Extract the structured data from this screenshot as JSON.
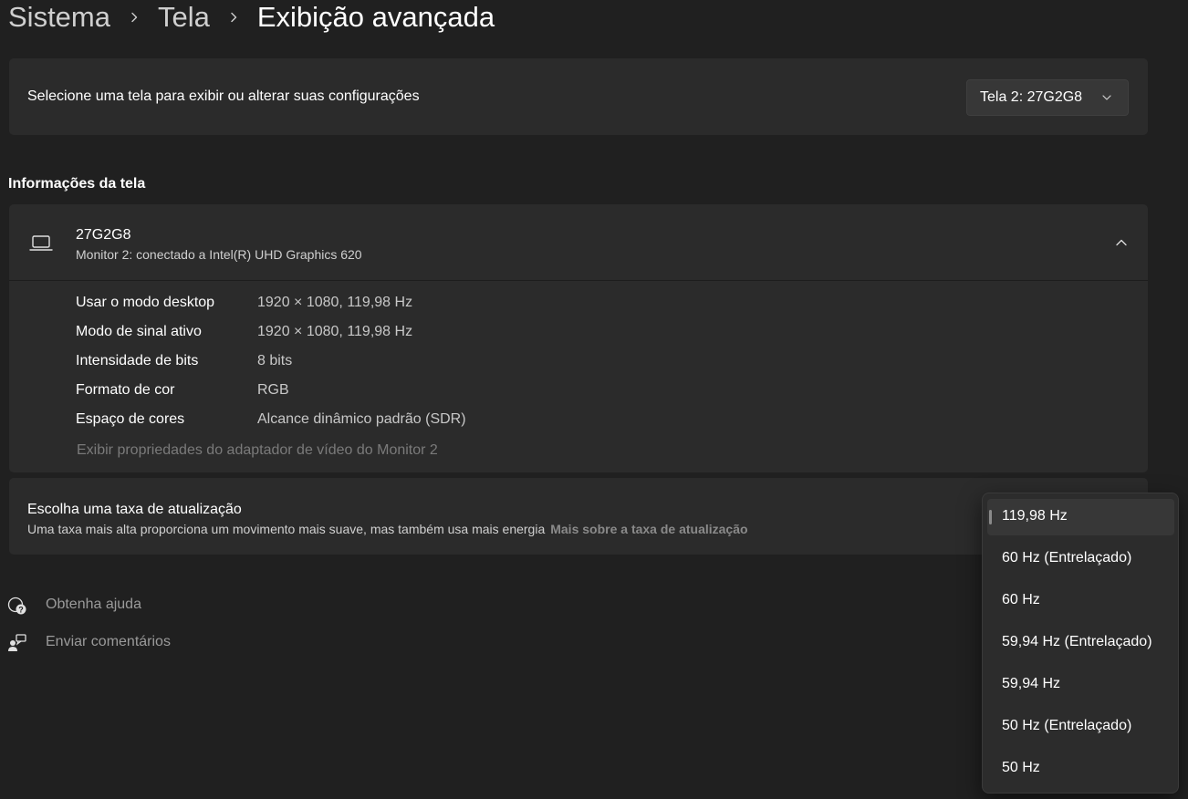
{
  "breadcrumb": {
    "items": [
      "Sistema",
      "Tela",
      "Exibição avançada"
    ]
  },
  "display_select": {
    "label": "Selecione uma tela para exibir ou alterar suas configurações",
    "selected": "Tela 2: 27G2G8"
  },
  "section_title": "Informações da tela",
  "monitor": {
    "name": "27G2G8",
    "subtitle": "Monitor 2: conectado a Intel(R) UHD Graphics 620",
    "details": [
      {
        "key": "Usar o modo desktop",
        "value": "1920 × 1080, 119,98 Hz"
      },
      {
        "key": "Modo de sinal ativo",
        "value": "1920 × 1080, 119,98 Hz"
      },
      {
        "key": "Intensidade de bits",
        "value": "8 bits"
      },
      {
        "key": "Formato de cor",
        "value": "RGB"
      },
      {
        "key": "Espaço de cores",
        "value": "Alcance dinâmico padrão (SDR)"
      }
    ],
    "adapter_link": "Exibir propriedades do adaptador de vídeo do Monitor 2"
  },
  "refresh": {
    "title": "Escolha uma taxa de atualização",
    "subtitle": "Uma taxa mais alta proporciona um movimento mais suave, mas também usa mais energia",
    "link": "Mais sobre a taxa de atualização",
    "options": [
      "119,98 Hz",
      "60 Hz (Entrelaçado)",
      "60 Hz",
      "59,94 Hz (Entrelaçado)",
      "59,94 Hz",
      "50 Hz (Entrelaçado)",
      "50 Hz"
    ],
    "selected_index": 0
  },
  "help": {
    "get_help": "Obtenha ajuda",
    "feedback": "Enviar comentários"
  },
  "colors": {
    "background": "#202020",
    "card": "#2b2b2b",
    "flyout": "#2c2c2c"
  }
}
